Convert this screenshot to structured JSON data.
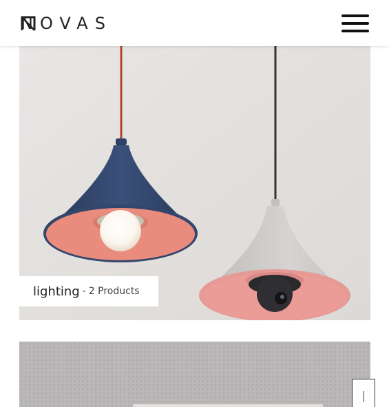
{
  "header": {
    "brand": "NOVAS",
    "menu_icon": "hamburger-menu-icon"
  },
  "category_card": {
    "name": "lighting",
    "separator": "-",
    "count": "2 Products",
    "image_subject": "two cone pendant lamps, one blue with bulb, one grey with camera",
    "colors": {
      "background": "#e6e4e2",
      "blue_shade": "#33466b",
      "coral_inner": "#e98c7d",
      "grey_shade": "#c8c6c4",
      "red_cord": "#b0472c"
    }
  },
  "next_card": {
    "background": "#b9b6b7"
  },
  "scroll_button": {
    "icon": "scroll-indicator-icon"
  }
}
